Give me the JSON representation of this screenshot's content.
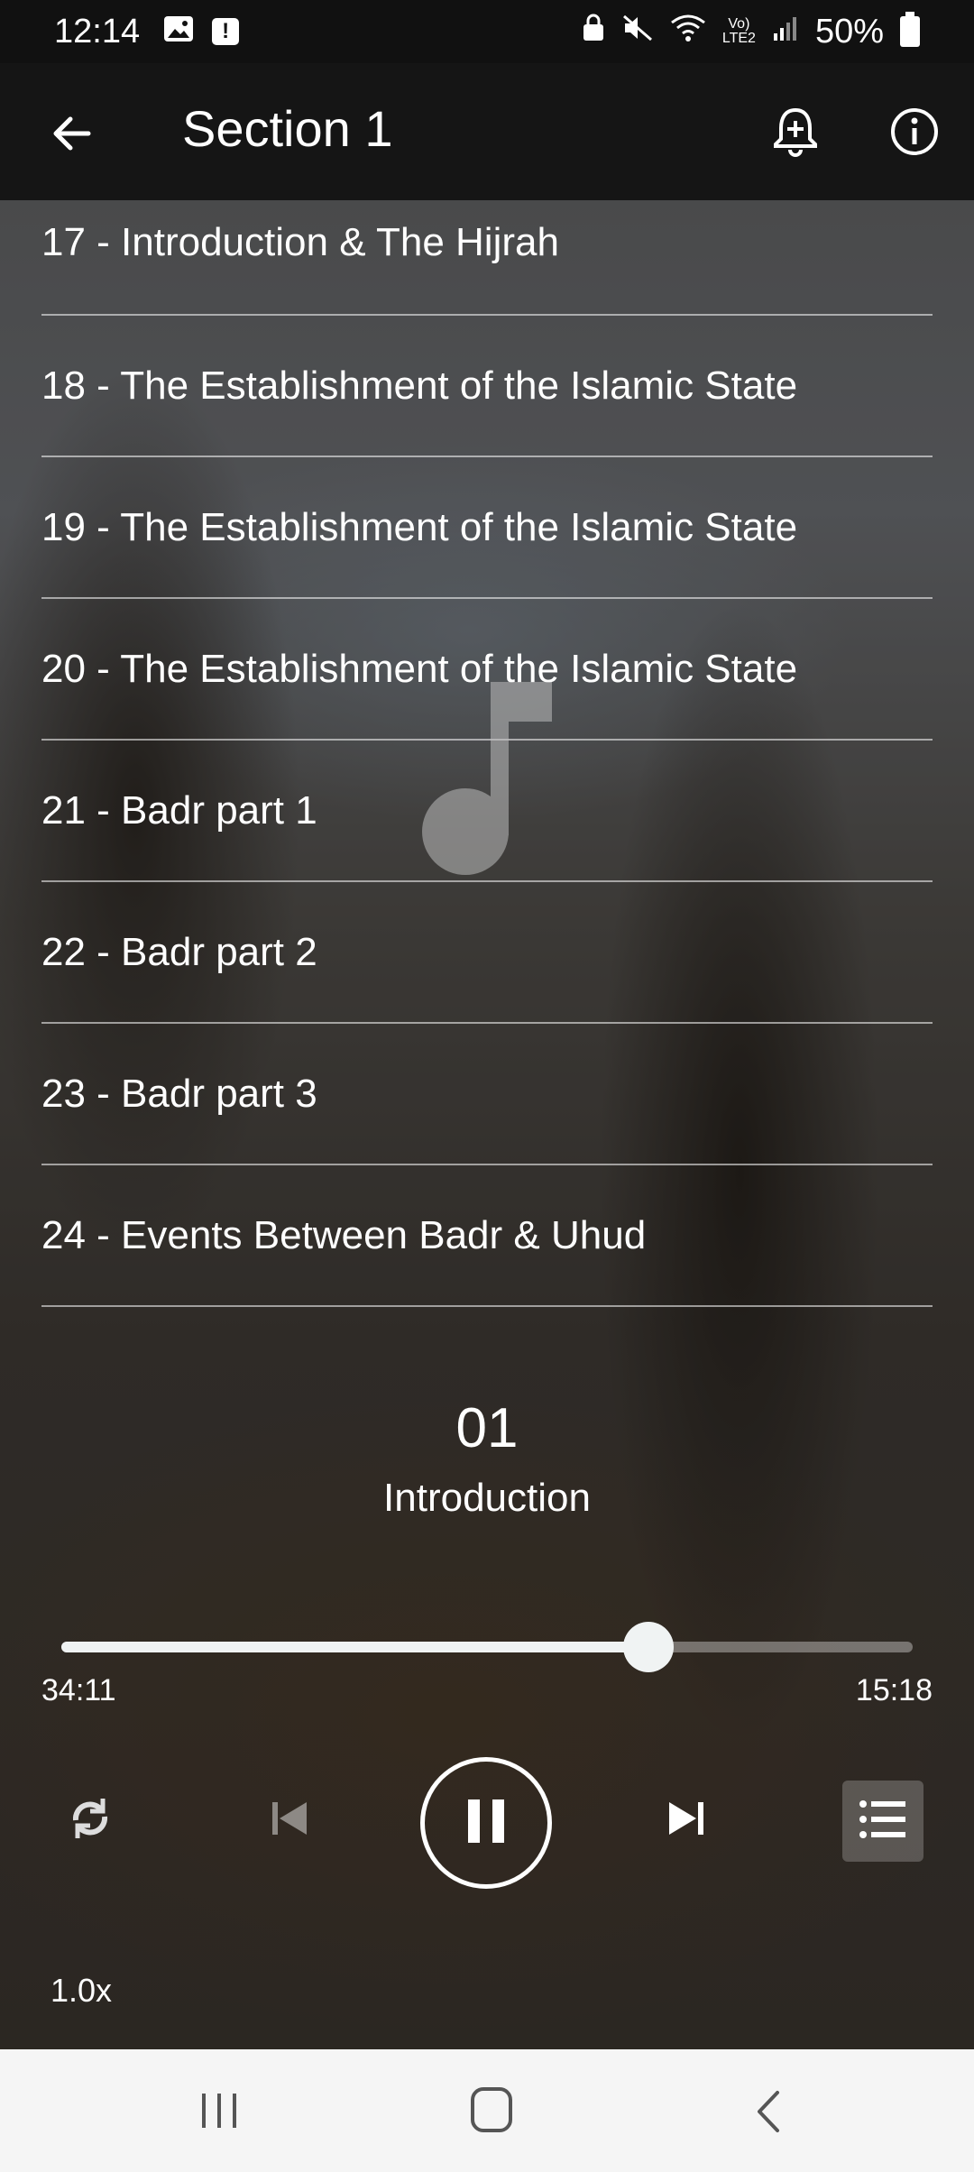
{
  "status_bar": {
    "time": "12:14",
    "battery": "50%",
    "icons": [
      "gallery-icon",
      "alert-icon",
      "lock-icon",
      "mute-icon",
      "wifi-icon",
      "volte-icon",
      "signal-icon",
      "battery-icon"
    ]
  },
  "app_bar": {
    "title": "Section 1",
    "icons": [
      "back-arrow-icon",
      "add-alarm-icon",
      "info-icon"
    ]
  },
  "tracks": [
    {
      "label": "17 - Introduction & The Hijrah"
    },
    {
      "label": "18 - The Establishment of the Islamic State"
    },
    {
      "label": "19 - The Establishment of the Islamic State"
    },
    {
      "label": "20 - The Establishment of the Islamic State"
    },
    {
      "label": "21 - Badr part 1"
    },
    {
      "label": "22 - Badr part 2"
    },
    {
      "label": "23 - Badr part 3"
    },
    {
      "label": "24 - Events Between Badr & Uhud"
    }
  ],
  "now_playing": {
    "number": "01",
    "title": "Introduction",
    "elapsed": "34:11",
    "remaining": "15:18",
    "progress_fraction": 0.69
  },
  "controls": {
    "speed": "1.0x",
    "icons": [
      "repeat-icon",
      "skip-previous-icon",
      "pause-icon",
      "skip-next-icon",
      "playlist-icon"
    ]
  },
  "colors": {
    "appbar_bg": "#151515",
    "status_bg": "#111111",
    "navbar_bg": "#f5f5f5",
    "progress": "#f0f3f3"
  }
}
